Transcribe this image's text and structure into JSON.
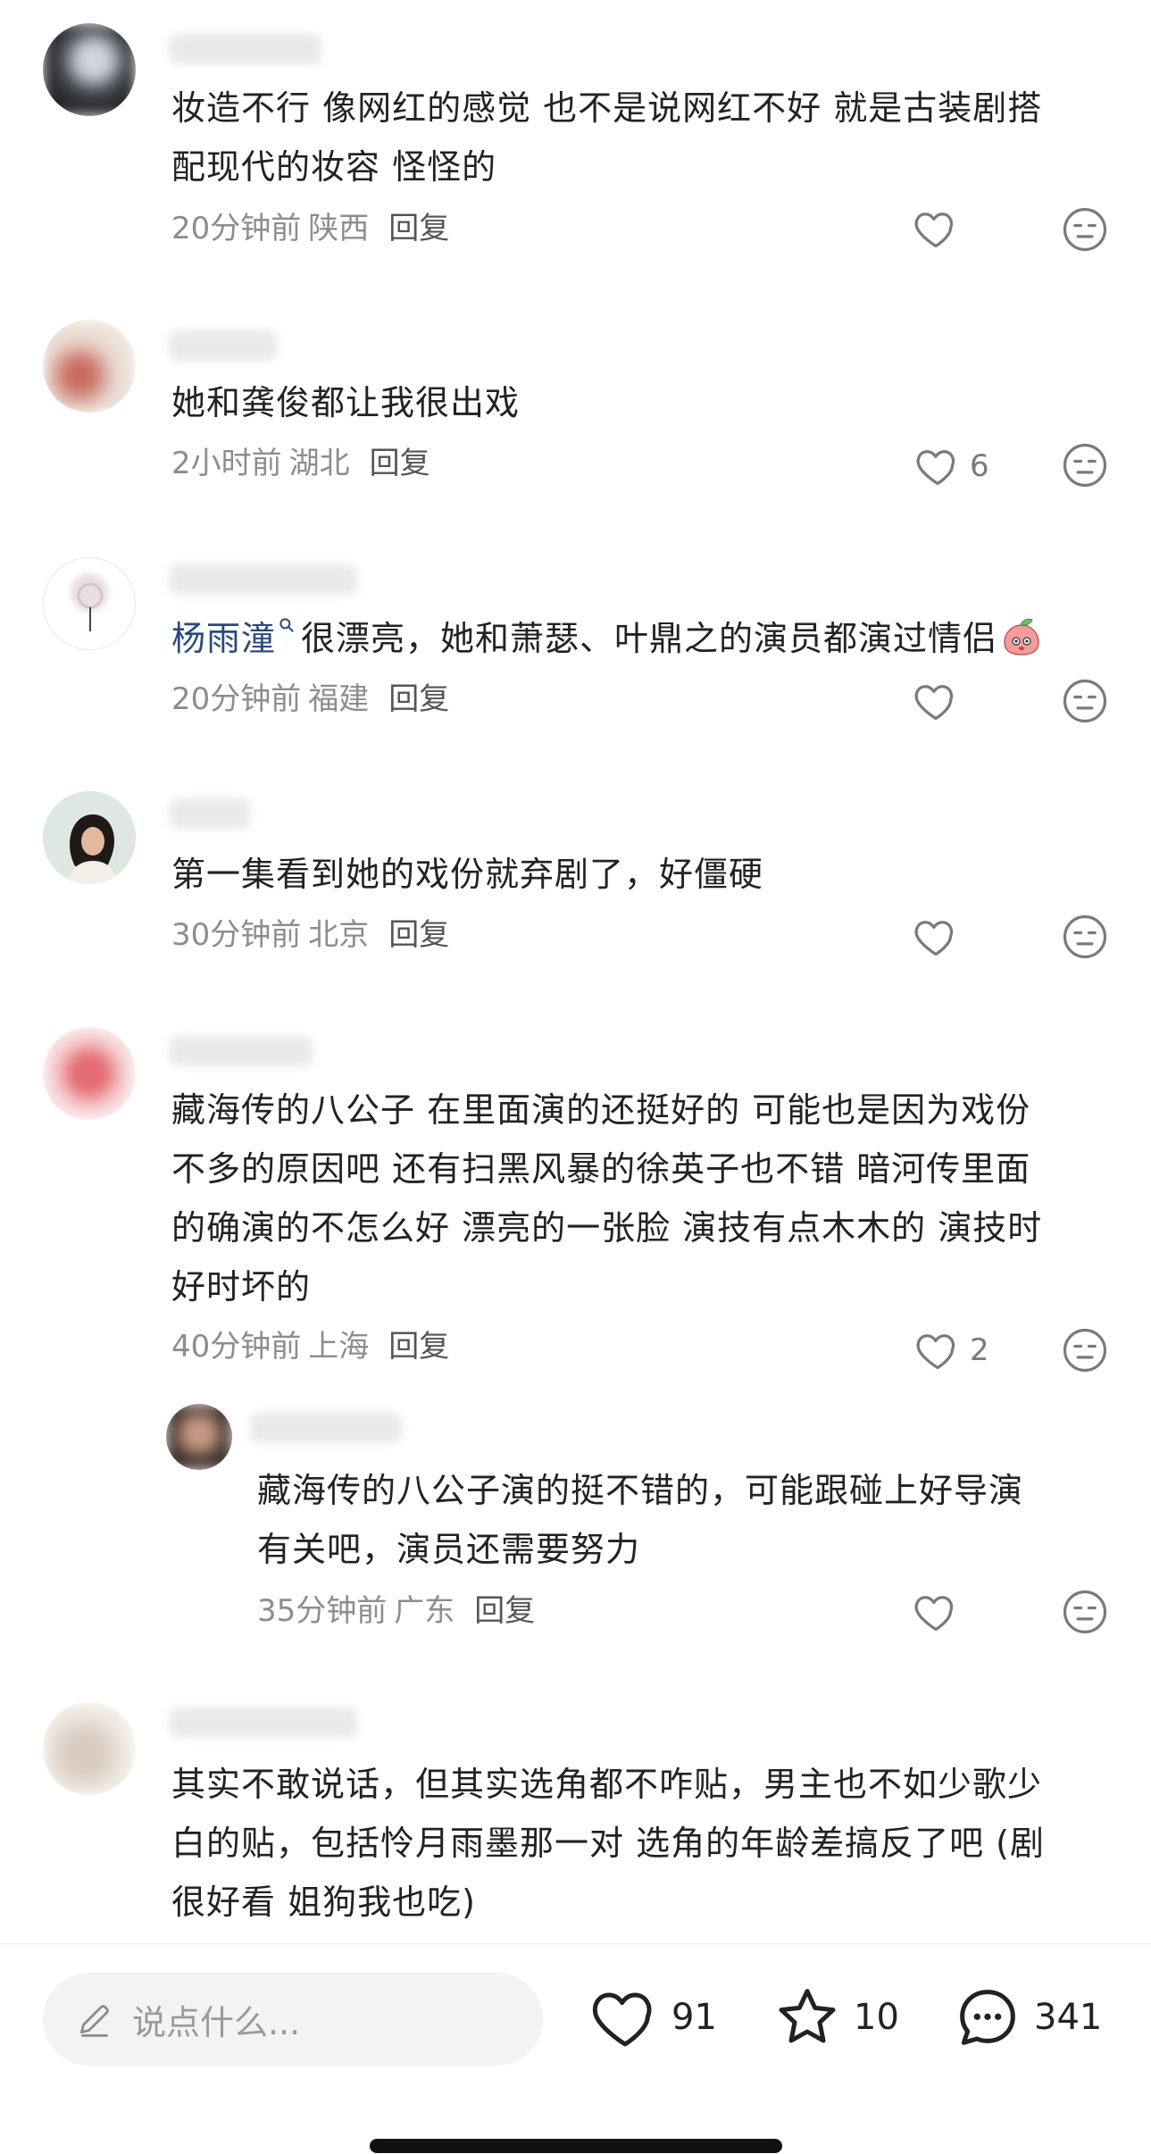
{
  "comments": [
    {
      "text_lines": [
        "妆造不行 像网红的感觉 也不是说网红不好 就是古装剧搭",
        "配现代的妆容 怪怪的"
      ],
      "time": "20分钟前",
      "location": "陕西",
      "reply": "回复",
      "likes": ""
    },
    {
      "text_lines": [
        "她和龚俊都让我很出戏"
      ],
      "time": "2小时前",
      "location": "湖北",
      "reply": "回复",
      "likes": "6"
    },
    {
      "mention": "杨雨潼",
      "text_lines": [
        "很漂亮，她和萧瑟、叶鼎之的演员都演过情侣"
      ],
      "time": "20分钟前",
      "location": "福建",
      "reply": "回复",
      "likes": ""
    },
    {
      "text_lines": [
        "第一集看到她的戏份就弃剧了，好僵硬"
      ],
      "time": "30分钟前",
      "location": "北京",
      "reply": "回复",
      "likes": ""
    },
    {
      "text_lines": [
        "藏海传的八公子 在里面演的还挺好的 可能也是因为戏份",
        "不多的原因吧 还有扫黑风暴的徐英子也不错 暗河传里面",
        "的确演的不怎么好 漂亮的一张脸 演技有点木木的 演技时",
        "好时坏的"
      ],
      "time": "40分钟前",
      "location": "上海",
      "reply": "回复",
      "likes": "2"
    },
    {
      "text_lines": [
        "藏海传的八公子演的挺不错的，可能跟碰上好导演",
        "有关吧，演员还需要努力"
      ],
      "time": "35分钟前",
      "location": "广东",
      "reply": "回复",
      "likes": ""
    },
    {
      "text_lines": [
        "其实不敢说话，但其实选角都不咋贴，男主也不如少歌少",
        "白的贴，包括怜月雨墨那一对 选角的年龄差搞反了吧 (剧",
        "很好看 姐狗我也吃)"
      ]
    }
  ],
  "bottom_bar": {
    "input_placeholder": "说点什么...",
    "likes": "91",
    "stars": "10",
    "comments": "341"
  },
  "icons": {
    "like": "heart-icon",
    "dislike": "dislike-face-icon",
    "edit": "pencil-icon",
    "star": "star-icon",
    "comment": "comment-bubble-icon",
    "search": "search-icon"
  },
  "colors": {
    "mention": "#2a4a7c",
    "meta": "#8d8d8d",
    "text": "#222222"
  }
}
